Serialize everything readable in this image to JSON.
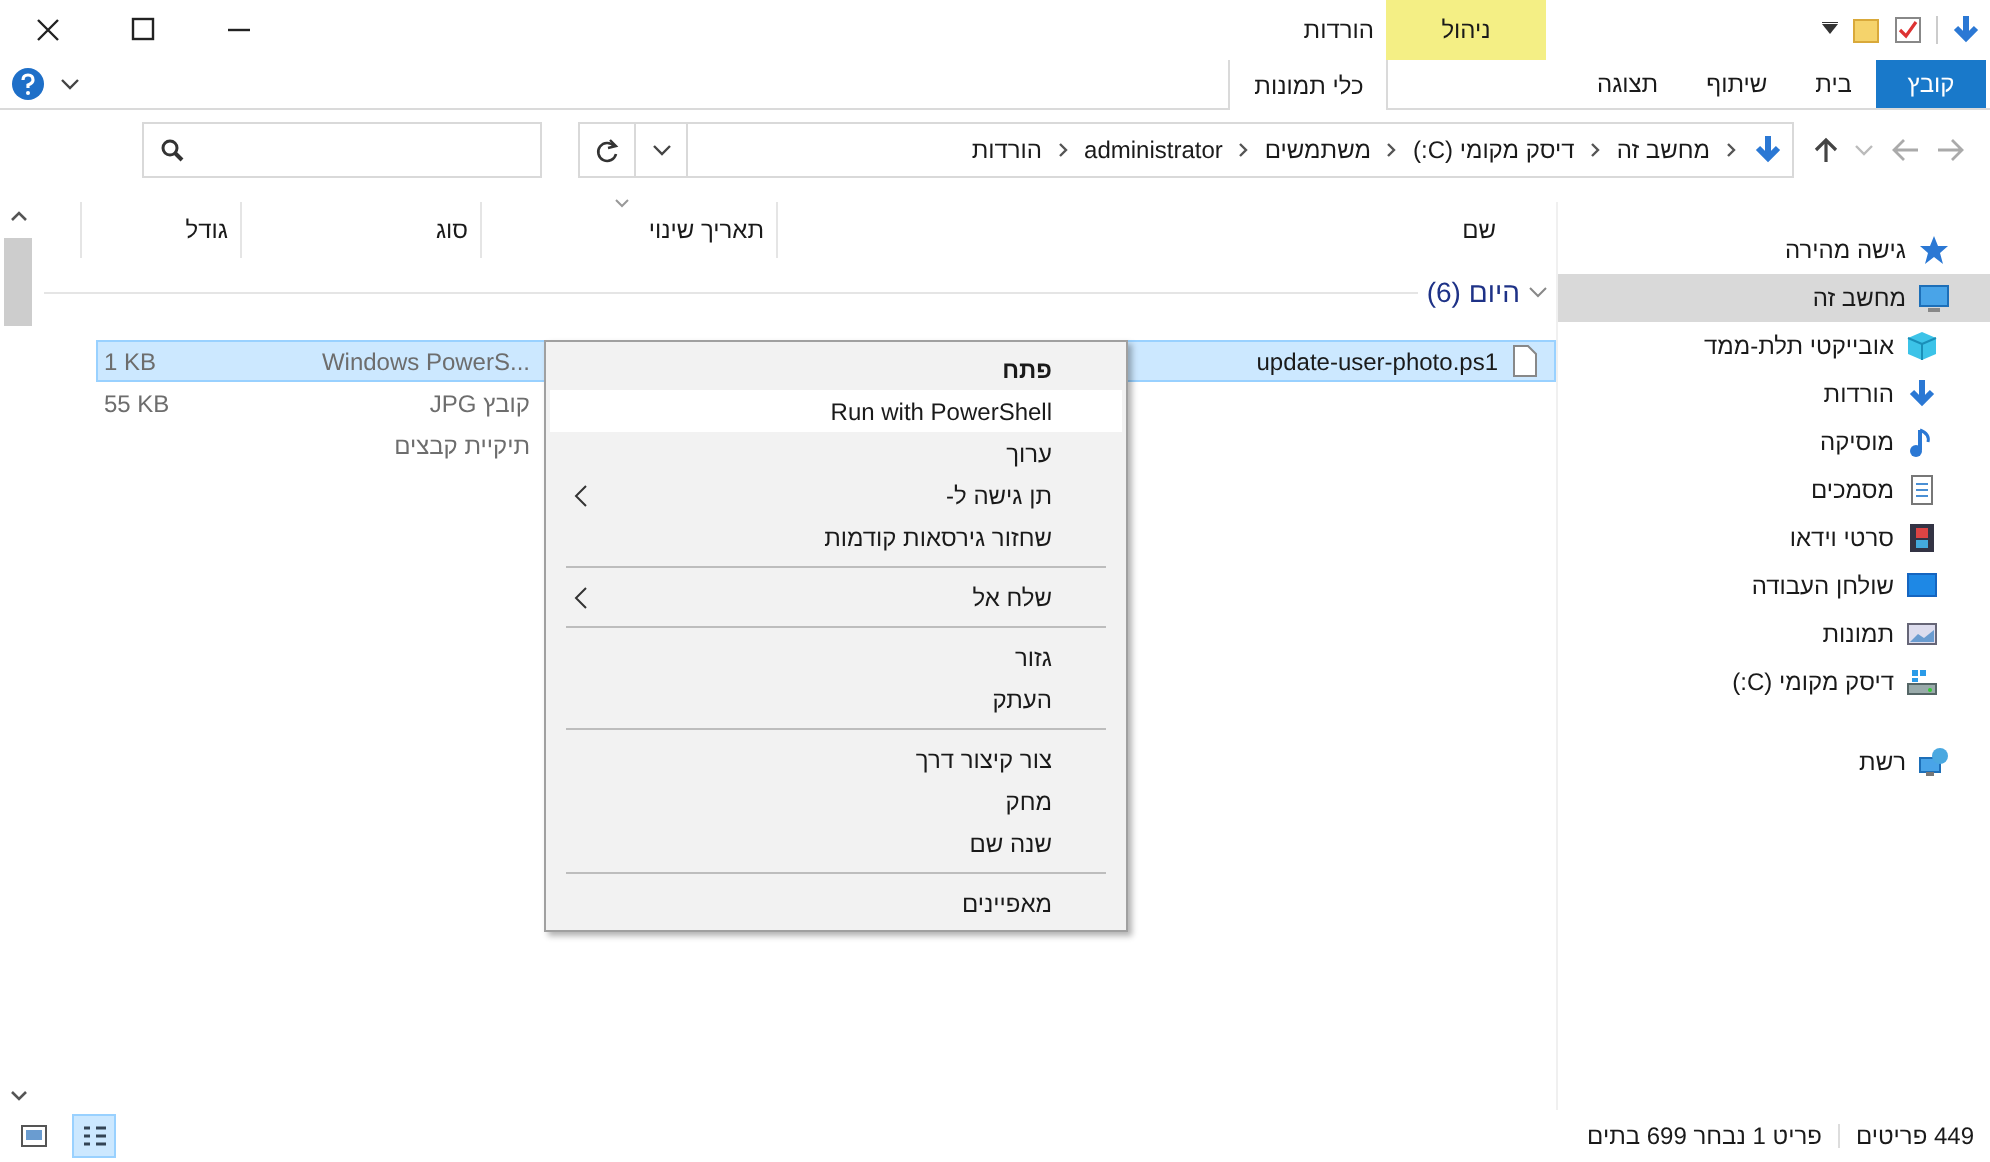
{
  "title_bar": {
    "title": "הורדות",
    "contextual_tab": "ניהול"
  },
  "ribbon_tabs": [
    {
      "label": "קובץ",
      "kind": "file"
    },
    {
      "label": "בית",
      "kind": "tab"
    },
    {
      "label": "שיתוף",
      "kind": "tab"
    },
    {
      "label": "תצוגה",
      "kind": "tab"
    },
    {
      "label": "כלי תמונות",
      "kind": "contextual"
    }
  ],
  "address_bar": {
    "path": [
      "מחשב זה",
      "דיסק מקומי (C:)",
      "משתמשים",
      "administrator",
      "הורדות"
    ]
  },
  "columns": [
    {
      "label": "שם",
      "sorted": false
    },
    {
      "label": "תאריך שינוי",
      "sorted": true
    },
    {
      "label": "סוג",
      "sorted": false
    },
    {
      "label": "גודל",
      "sorted": false
    }
  ],
  "group": {
    "label": "היום (6)",
    "expanded": true
  },
  "rows": [
    {
      "name": "update-user-photo.ps1",
      "type": "Windows PowerS...",
      "size": "1 KB",
      "selected": true
    },
    {
      "type": "קובץ JPG",
      "size": "55 KB",
      "selected": false
    },
    {
      "type": "תיקיית קבצים",
      "selected": false
    }
  ],
  "nav_pane": [
    {
      "label": "גישה מהירה",
      "kind": "star",
      "selected": false
    },
    {
      "label": "מחשב זה",
      "kind": "pc",
      "selected": true,
      "children": [
        {
          "label": "אובייקטי תלת-ממד",
          "kind": "cube",
          "selected": false
        },
        {
          "label": "הורדות",
          "kind": "download",
          "selected": false
        },
        {
          "label": "מוסיקה",
          "kind": "music",
          "selected": false
        },
        {
          "label": "מסמכים",
          "kind": "document",
          "selected": false
        },
        {
          "label": "סרטי וידאו",
          "kind": "film",
          "selected": false
        },
        {
          "label": "שולחן העבודה",
          "kind": "desktop",
          "selected": false
        },
        {
          "label": "תמונות",
          "kind": "pictures",
          "selected": false
        },
        {
          "label": "דיסק מקומי (C:)",
          "kind": "drive",
          "selected": false
        }
      ]
    },
    {
      "label": "רשת",
      "kind": "network",
      "selected": false
    }
  ],
  "context_menu": [
    {
      "kind": "item",
      "label": "פתח",
      "default": true,
      "highlighted": false,
      "submenu": false
    },
    {
      "kind": "item",
      "label": "Run with PowerShell",
      "default": false,
      "highlighted": true,
      "submenu": false
    },
    {
      "kind": "item",
      "label": "ערוך",
      "default": false,
      "highlighted": false,
      "submenu": false
    },
    {
      "kind": "item",
      "label": "תן גישה ל-",
      "default": false,
      "highlighted": false,
      "submenu": true
    },
    {
      "kind": "item",
      "label": "שחזור גירסאות קודמות",
      "default": false,
      "highlighted": false,
      "submenu": false
    },
    {
      "kind": "separator"
    },
    {
      "kind": "item",
      "label": "שלח אל",
      "default": false,
      "highlighted": false,
      "submenu": true
    },
    {
      "kind": "separator"
    },
    {
      "kind": "item",
      "label": "גזור",
      "default": false,
      "highlighted": false,
      "submenu": false
    },
    {
      "kind": "item",
      "label": "העתק",
      "default": false,
      "highlighted": false,
      "submenu": false
    },
    {
      "kind": "separator"
    },
    {
      "kind": "item",
      "label": "צור קיצור דרך",
      "default": false,
      "highlighted": false,
      "submenu": false
    },
    {
      "kind": "item",
      "label": "מחק",
      "default": false,
      "highlighted": false,
      "submenu": false
    },
    {
      "kind": "item",
      "label": "שנה שם",
      "default": false,
      "highlighted": false,
      "submenu": false
    },
    {
      "kind": "separator"
    },
    {
      "kind": "item",
      "label": "מאפיינים",
      "default": false,
      "highlighted": false,
      "submenu": false
    }
  ],
  "status_bar": {
    "item_count": "449 פריטים",
    "selection": "פריט 1 נבחר 699 בתים"
  },
  "view_buttons": [
    {
      "kind": "details",
      "selected": true
    },
    {
      "kind": "thumbnails",
      "selected": false
    }
  ]
}
